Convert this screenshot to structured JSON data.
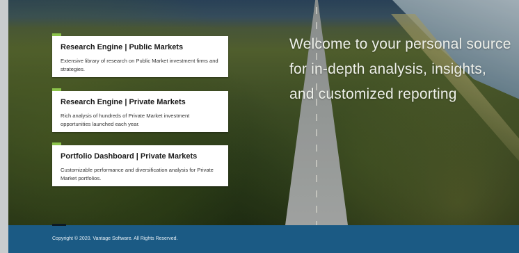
{
  "cards": [
    {
      "title": "Research Engine | Public Markets",
      "description": "Extensive library of research on Public Market investment firms and strategies."
    },
    {
      "title": "Research Engine | Private Markets",
      "description": "Rich analysis of hundreds of Private Market investment opportunities launched each year."
    },
    {
      "title": "Portfolio Dashboard | Private Markets",
      "description": "Customizable performance and diversification analysis for Private Market portfolios."
    }
  ],
  "hero": {
    "welcome": "Welcome to your personal source for in-depth analysis, insights, and customized reporting"
  },
  "footer": {
    "copyright": "Copyright © 2020. Vantage Software. All Rights Reserved."
  },
  "colors": {
    "accent": "#8bc34a",
    "footer": "#1b5a84"
  }
}
